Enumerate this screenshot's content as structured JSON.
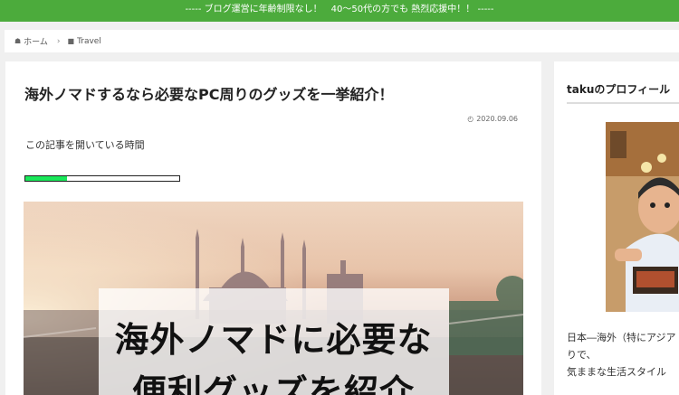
{
  "topbar": {
    "text": "----- ブログ運営に年齢制限なし！　40〜50代の方でも 熱烈応援中！！ -----"
  },
  "breadcrumb": {
    "home_label": "ホーム",
    "category_label": "Travel"
  },
  "article": {
    "title": "海外ノマドするなら必要なPC周りのグッズを一挙紹介！",
    "date": "2020.09.06",
    "reading_time_label": "この記事を開いている時間",
    "reading_progress_percent": 27,
    "hero": {
      "line1": "海外ノマドに必要な",
      "line2": "便利グッズを紹介"
    }
  },
  "sidebar": {
    "profile_heading": "takuのプロフィール",
    "bio_lines": [
      "日本―海外（特にアジア",
      "りで、",
      "気ままな生活スタイル"
    ]
  },
  "colors": {
    "topbar": "#4cab3c",
    "progress_fill": "#1ae85a"
  }
}
